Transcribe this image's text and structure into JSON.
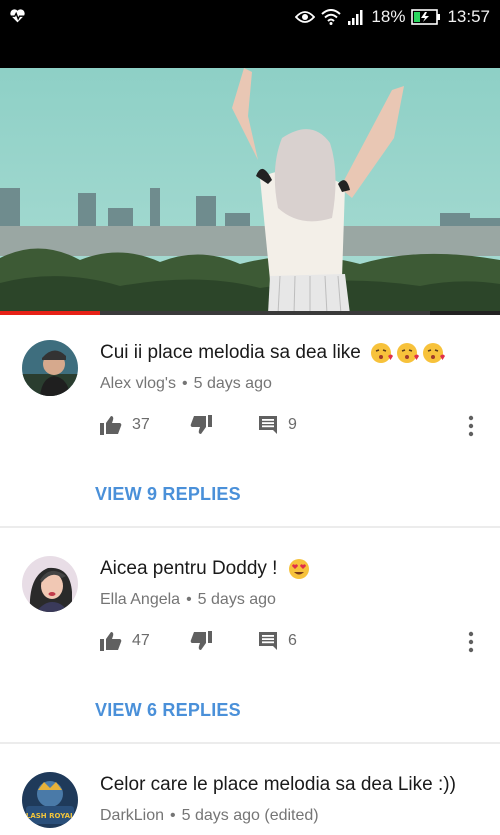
{
  "status_bar": {
    "battery": "18%",
    "time": "13:57"
  },
  "video": {
    "progress_fraction": 0.2
  },
  "comments": [
    {
      "text": "Cui ii place melodia sa dea like",
      "author": "Alex vlog's",
      "separator": "•",
      "time": "5 days ago",
      "likes": "37",
      "reply_count": "9",
      "view_replies": "VIEW 9 REPLIES",
      "emoji": [
        "kissing-heart",
        "kissing-heart",
        "kissing-heart"
      ]
    },
    {
      "text": "Aicea pentru Doddy !",
      "author": "Ella Angela",
      "separator": "•",
      "time": "5 days ago",
      "likes": "47",
      "reply_count": "6",
      "view_replies": "VIEW 6 REPLIES",
      "emoji": [
        "heart-eyes"
      ]
    },
    {
      "text": "Celor care le place melodia sa dea Like :))",
      "author": "DarkLion",
      "separator": "•",
      "time": "5 days ago (edited)",
      "avatar_text": "CLASH ROYALE"
    }
  ],
  "colors": {
    "accent_blue": "#4a90d9",
    "progress_red": "#e62117",
    "meta_gray": "#757575"
  }
}
